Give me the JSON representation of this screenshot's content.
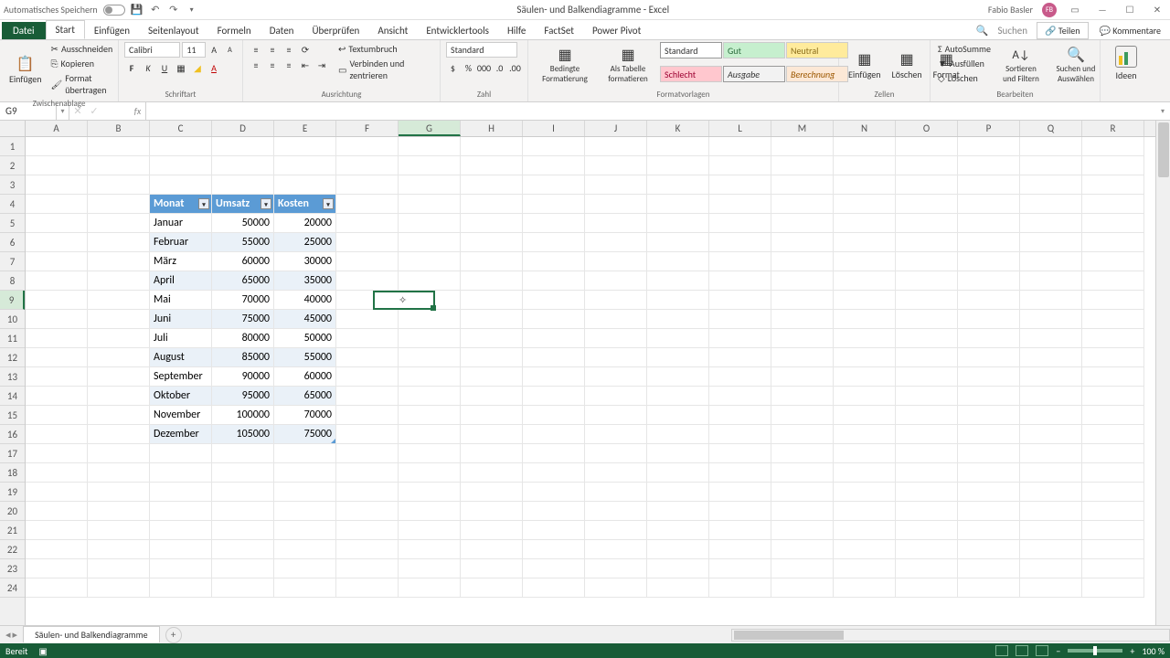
{
  "titlebar": {
    "auto_save": "Automatisches Speichern",
    "doc_title": "Säulen- und Balkendiagramme - Excel",
    "user": "Fabio Basler",
    "avatar_initials": "FB"
  },
  "tabs": {
    "file": "Datei",
    "list": [
      "Start",
      "Einfügen",
      "Seitenlayout",
      "Formeln",
      "Daten",
      "Überprüfen",
      "Ansicht",
      "Entwicklertools",
      "Hilfe",
      "FactSet",
      "Power Pivot"
    ],
    "search_icon": "🔍",
    "search": "Suchen",
    "share": "Teilen",
    "comments": "Kommentare"
  },
  "ribbon": {
    "clipboard": {
      "label": "Zwischenablage",
      "paste": "Einfügen",
      "cut": "Ausschneiden",
      "copy": "Kopieren",
      "format": "Format übertragen"
    },
    "font": {
      "label": "Schriftart",
      "name": "Calibri",
      "size": "11"
    },
    "align": {
      "label": "Ausrichtung",
      "wrap": "Textumbruch",
      "merge": "Verbinden und zentrieren"
    },
    "number": {
      "label": "Zahl",
      "format": "Standard"
    },
    "styles": {
      "label": "Formatvorlagen",
      "cond": "Bedingte Formatierung",
      "table": "Als Tabelle formatieren",
      "s1": "Standard",
      "s2": "Gut",
      "s3": "Neutral",
      "s4": "Schlecht",
      "s5": "Ausgabe",
      "s6": "Berechnung"
    },
    "cells": {
      "label": "Zellen",
      "insert": "Einfügen",
      "delete": "Löschen",
      "format": "Format"
    },
    "editing": {
      "label": "Bearbeiten",
      "sum": "AutoSumme",
      "fill": "Ausfüllen",
      "clear": "Löschen",
      "sort": "Sortieren und Filtern",
      "find": "Suchen und Auswählen"
    },
    "ideas": "Ideen"
  },
  "namebox": "G9",
  "columns": [
    "A",
    "B",
    "C",
    "D",
    "E",
    "F",
    "G",
    "H",
    "I",
    "J",
    "K",
    "L",
    "M",
    "N",
    "O",
    "P",
    "Q",
    "R"
  ],
  "active_col": "G",
  "active_row": 9,
  "table": {
    "headers": [
      "Monat",
      "Umsatz",
      "Kosten"
    ],
    "rows": [
      [
        "Januar",
        "50000",
        "20000"
      ],
      [
        "Februar",
        "55000",
        "25000"
      ],
      [
        "März",
        "60000",
        "30000"
      ],
      [
        "April",
        "65000",
        "35000"
      ],
      [
        "Mai",
        "70000",
        "40000"
      ],
      [
        "Juni",
        "75000",
        "45000"
      ],
      [
        "Juli",
        "80000",
        "50000"
      ],
      [
        "August",
        "85000",
        "55000"
      ],
      [
        "September",
        "90000",
        "60000"
      ],
      [
        "Oktober",
        "95000",
        "65000"
      ],
      [
        "November",
        "100000",
        "70000"
      ],
      [
        "Dezember",
        "105000",
        "75000"
      ]
    ]
  },
  "sheet": {
    "name": "Säulen- und Balkendiagramme"
  },
  "status": {
    "ready": "Bereit",
    "zoom": "100 %"
  }
}
